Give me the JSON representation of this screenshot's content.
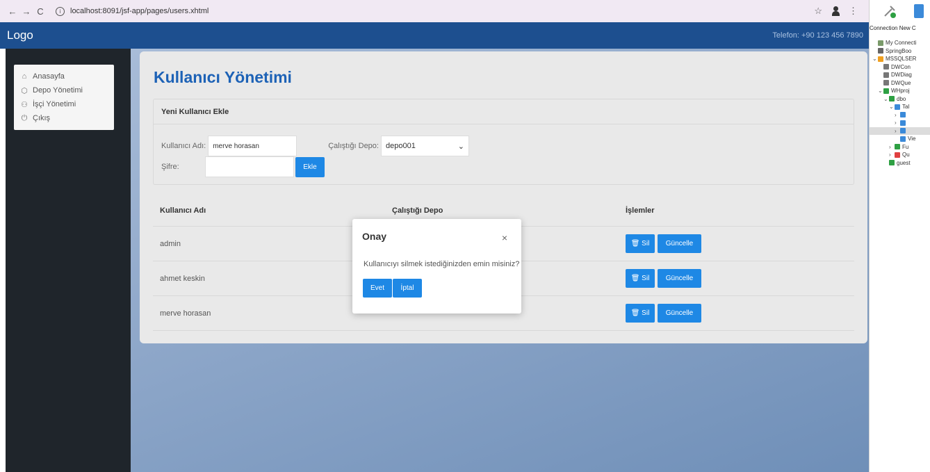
{
  "browser": {
    "back": "←",
    "forward": "→",
    "reload": "C",
    "url": "localhost:8091/jsf-app/pages/users.xhtml",
    "star": "☆",
    "menu": "⋮"
  },
  "header": {
    "logo": "Logo",
    "phone": "Telefon: +90 123 456 7890"
  },
  "sidebar": {
    "items": [
      {
        "icon": "⌂",
        "label": "Anasayfa"
      },
      {
        "icon": "⬡",
        "label": "Depo Yönetimi"
      },
      {
        "icon": "⚇",
        "label": "İşçi Yönetimi"
      },
      {
        "icon": "⏻",
        "label": "Çıkış"
      }
    ]
  },
  "page": {
    "title": "Kullanıcı Yönetimi"
  },
  "add_form": {
    "header": "Yeni Kullanıcı Ekle",
    "username_label": "Kullanıcı Adı:",
    "username_value": "merve horasan",
    "depot_label": "Çalıştığı Depo:",
    "depot_value": "depo001",
    "password_label": "Şifre:",
    "password_value": "",
    "add_button": "Ekle"
  },
  "table": {
    "headers": [
      "Kullanıcı Adı",
      "Çalıştığı Depo",
      "İşlemler"
    ],
    "rows": [
      {
        "username": "admin",
        "depot": ""
      },
      {
        "username": "ahmet keskin",
        "depot": ""
      },
      {
        "username": "merve horasan",
        "depot": ""
      }
    ],
    "delete_label": "Sil",
    "update_label": "Güncelle"
  },
  "modal": {
    "title": "Onay",
    "close": "×",
    "message": "Kullanıcıyı silmek istediğinizden emin misiniz?",
    "yes": "Evet",
    "cancel": "İptal"
  },
  "db_panel": {
    "toolbar_labels": "Connection  New C",
    "tree": [
      {
        "label": "My Connecti",
        "indent": 0,
        "chev": "",
        "color": "#7a9a6a"
      },
      {
        "label": "SpringBoo",
        "indent": 0,
        "chev": "",
        "color": "#666666"
      },
      {
        "label": "MSSQLSER",
        "indent": 0,
        "chev": "⌄",
        "color": "#f0a020"
      },
      {
        "label": "DWCon",
        "indent": 1,
        "chev": "",
        "color": "#777777"
      },
      {
        "label": "DWDiag",
        "indent": 1,
        "chev": "",
        "color": "#777777"
      },
      {
        "label": "DWQue",
        "indent": 1,
        "chev": "",
        "color": "#777777"
      },
      {
        "label": "WHproj",
        "indent": 1,
        "chev": "⌄",
        "color": "#2ea043"
      },
      {
        "label": "dbo",
        "indent": 2,
        "chev": "⌄",
        "color": "#2ea043"
      },
      {
        "label": "Tal",
        "indent": 3,
        "chev": "⌄",
        "color": "#3b8ad9"
      },
      {
        "label": "",
        "indent": 4,
        "chev": "›",
        "color": "#3b8ad9"
      },
      {
        "label": "",
        "indent": 4,
        "chev": "›",
        "color": "#3b8ad9"
      },
      {
        "label": "",
        "indent": 4,
        "chev": "›",
        "color": "#3b8ad9",
        "selected": true
      },
      {
        "label": "Vie",
        "indent": 4,
        "chev": "",
        "color": "#3b8ad9"
      },
      {
        "label": "Fu",
        "indent": 3,
        "chev": "›",
        "color": "#2ea043"
      },
      {
        "label": "Qu",
        "indent": 3,
        "chev": "›",
        "color": "#e04040"
      },
      {
        "label": "guest",
        "indent": 2,
        "chev": "",
        "color": "#2ea043"
      }
    ]
  }
}
